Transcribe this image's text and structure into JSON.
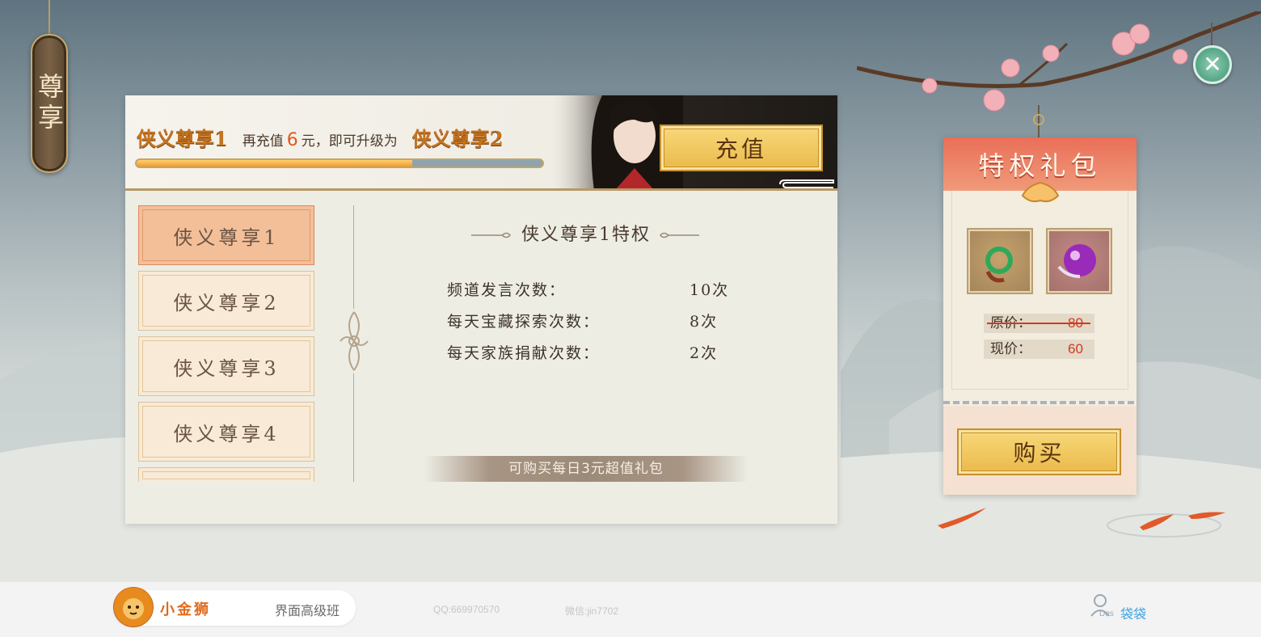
{
  "side_tag": {
    "label": "尊享"
  },
  "header": {
    "current_level": "侠义尊享1",
    "message_prefix": "再充值",
    "amount": "6",
    "message_suffix": "元，即可升级为",
    "next_level": "侠义尊享2",
    "progress_percent": 68,
    "recharge_label": "充值"
  },
  "tabs": [
    {
      "label": "侠义尊享1",
      "active": true
    },
    {
      "label": "侠义尊享2",
      "active": false
    },
    {
      "label": "侠义尊享3",
      "active": false
    },
    {
      "label": "侠义尊享4",
      "active": false
    }
  ],
  "content": {
    "title": "侠义尊享1特权",
    "perks": [
      {
        "label": "频道发言次数：",
        "value": "10次"
      },
      {
        "label": "每天宝藏探索次数：",
        "value": "8次"
      },
      {
        "label": "每天家族捐献次数：",
        "value": "2次"
      }
    ],
    "footer_note": "可购买每日3元超值礼包"
  },
  "gift": {
    "title": "特权礼包",
    "items": [
      "jade-pendant-icon",
      "purple-orb-icon"
    ],
    "original_price_label": "原价：",
    "original_price": "80",
    "current_price_label": "现价：",
    "current_price": "60",
    "buy_label": "购买"
  },
  "bottom_bar": {
    "brand_name": "小金狮",
    "course": "界面高级班",
    "qq": "QQ:669970570",
    "wechat": "微信:jin7702",
    "user_sub": "Des",
    "user_name": "袋袋"
  },
  "colors": {
    "accent_orange": "#e05a1e",
    "gold_button": "#eab94a",
    "gift_header": "#e96f58",
    "active_tab": "#f3bf99"
  }
}
